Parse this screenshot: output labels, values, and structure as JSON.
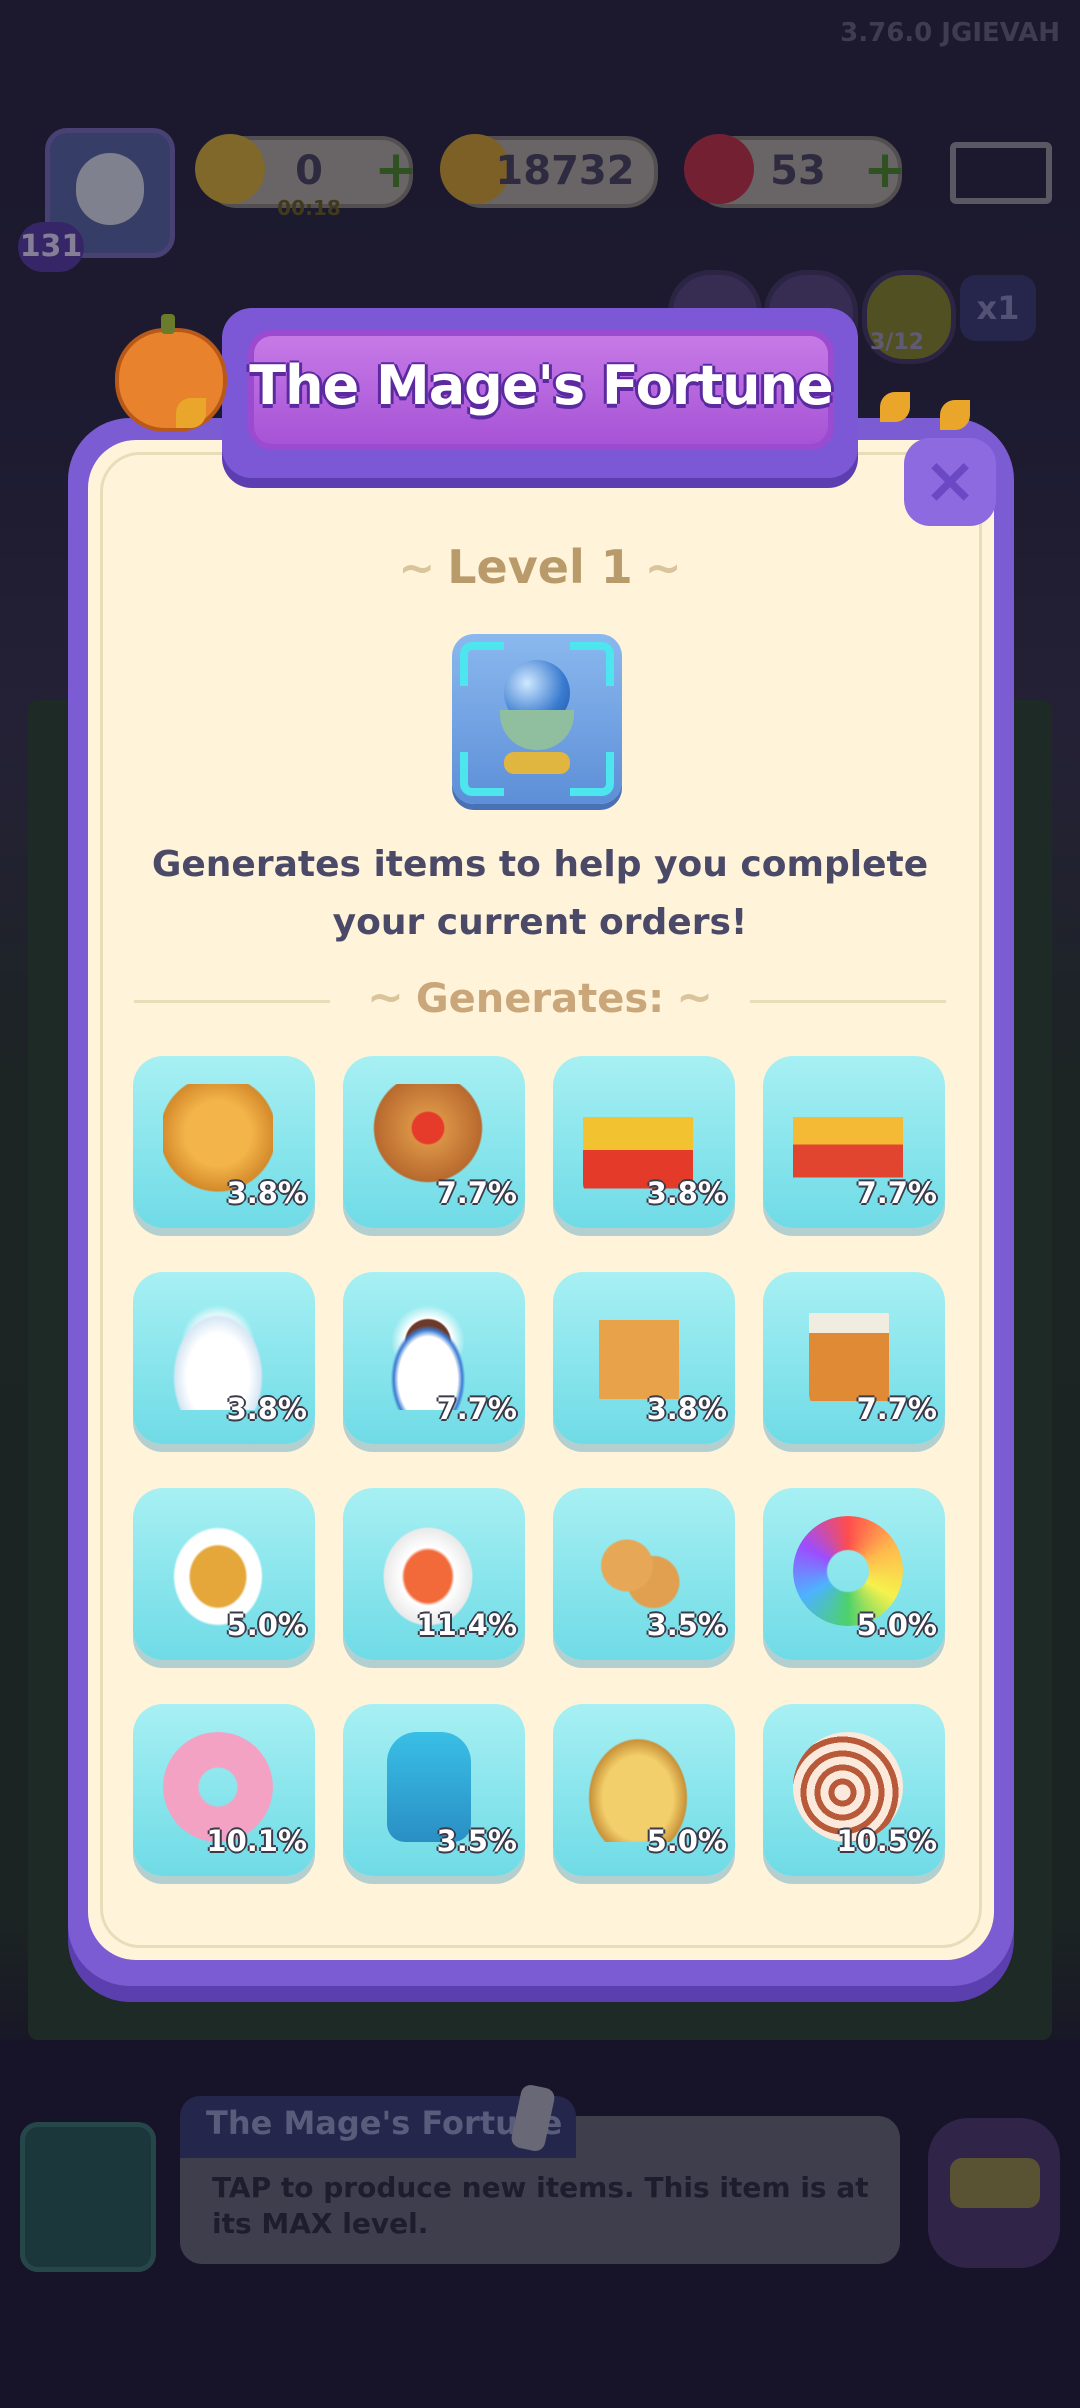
{
  "version": "3.76.0 JGIEVAH",
  "player": {
    "level": "131"
  },
  "currencies": {
    "energy": "0",
    "energy_timer": "00:18",
    "coins": "18732",
    "gems": "53"
  },
  "event": {
    "progress": "3/12",
    "multiplier": "x1"
  },
  "popup": {
    "title": "The Mage's Fortune",
    "close_label": "×",
    "level_label": "Level 1",
    "description": "Generates items to help you complete your current orders!",
    "generates_label": "Generates:",
    "items": [
      {
        "icon": "bread-loaf",
        "chance": "3.8%"
      },
      {
        "icon": "toast-with-jam",
        "chance": "7.7%"
      },
      {
        "icon": "french-fries",
        "chance": "3.8%"
      },
      {
        "icon": "loaded-fries",
        "chance": "7.7%"
      },
      {
        "icon": "coffee-cup",
        "chance": "3.8%"
      },
      {
        "icon": "coffee-cup-saucer",
        "chance": "7.7%"
      },
      {
        "icon": "iced-tea-glass",
        "chance": "3.8%"
      },
      {
        "icon": "iced-tea-jar",
        "chance": "7.7%"
      },
      {
        "icon": "grilled-fish",
        "chance": "5.0%"
      },
      {
        "icon": "shrimp-plate",
        "chance": "11.4%"
      },
      {
        "icon": "donuts",
        "chance": "3.5%"
      },
      {
        "icon": "rainbow-float-ring",
        "chance": "5.0%"
      },
      {
        "icon": "pink-float-ring",
        "chance": "10.1%"
      },
      {
        "icon": "life-vest",
        "chance": "3.5%"
      },
      {
        "icon": "conch-shell",
        "chance": "5.0%"
      },
      {
        "icon": "nautilus-shell",
        "chance": "10.5%"
      }
    ]
  },
  "info_bar": {
    "title": "The Mage's Fortune",
    "text": "TAP to produce new items. This item is at its MAX level."
  }
}
